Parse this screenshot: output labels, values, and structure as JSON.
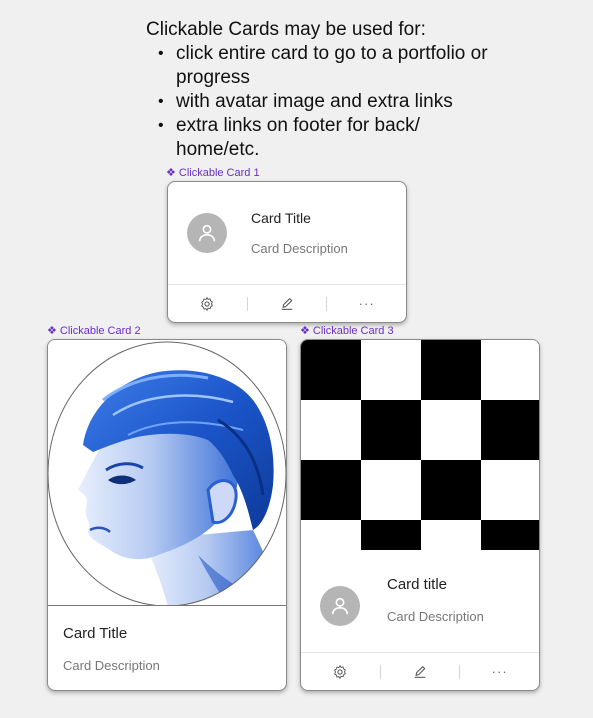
{
  "intro": {
    "title": "Clickable Cards may be used for:",
    "bullets": [
      "click entire card to go to a portfolio or progress",
      "with avatar image and extra links",
      "extra links on footer for back/ home/etc."
    ]
  },
  "card1": {
    "component_label": "Clickable Card 1",
    "title": "Card Title",
    "description": "Card Description",
    "footer_icons": [
      "gear-icon",
      "pencil-icon",
      "more-icon"
    ],
    "more_text": "···"
  },
  "card2": {
    "component_label": "Clickable Card 2",
    "image": "blue-toned-portrait-in-oval",
    "title": "Card Title",
    "description": "Card Description"
  },
  "card3": {
    "component_label": "Clickable Card 3",
    "image": "black-white-checkerboard",
    "title": "Card title",
    "description": "Card Description",
    "footer_icons": [
      "gear-icon",
      "pencil-icon",
      "more-icon"
    ],
    "more_text": "···"
  },
  "colors": {
    "background": "#f0f0f0",
    "component_label": "#6a2fc7",
    "avatar": "#b5b5b5",
    "portrait_blue": "#1f5fd6"
  },
  "diamond_glyph": "❖"
}
